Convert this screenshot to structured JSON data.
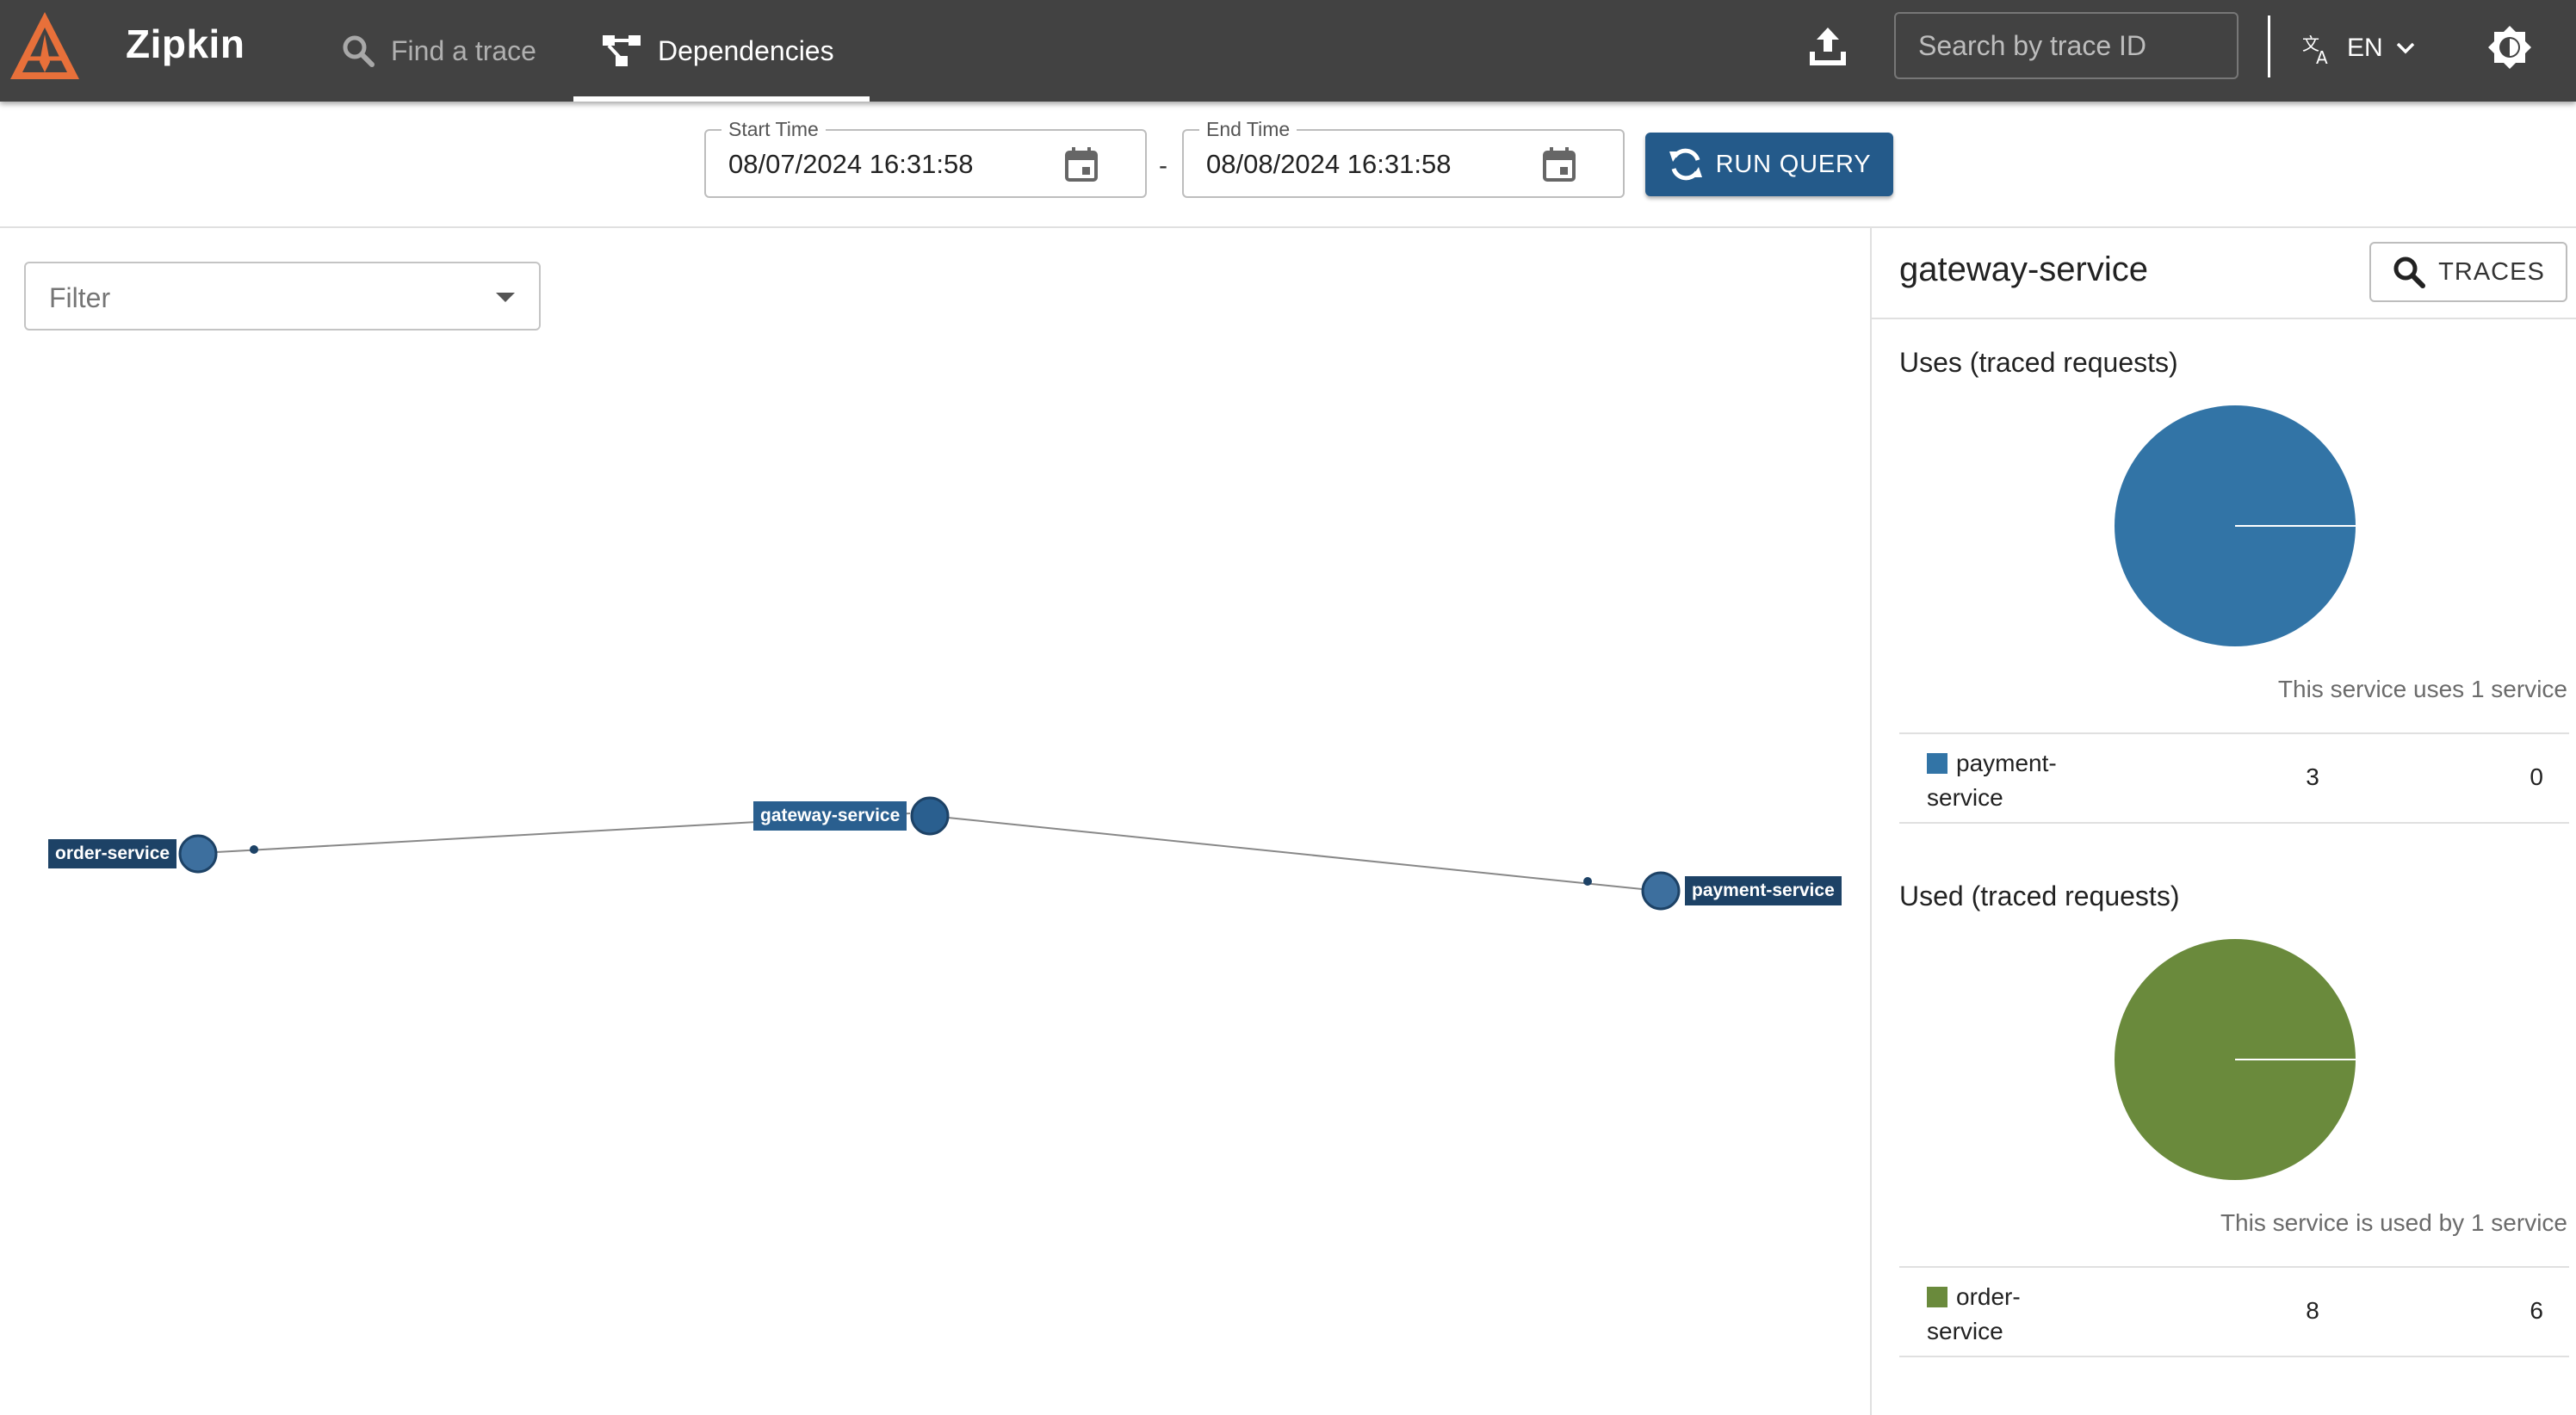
{
  "app": {
    "brand": "Zipkin",
    "logo_icon": "zipkin-logo-icon",
    "accent_color": "#e8703a"
  },
  "nav": {
    "find_trace": "Find a trace",
    "dependencies": "Dependencies"
  },
  "header": {
    "search_placeholder": "Search by trace ID",
    "language": "EN"
  },
  "query": {
    "start_label": "Start Time",
    "start_value": "08/07/2024 16:31:58",
    "separator": "-",
    "end_label": "End Time",
    "end_value": "08/08/2024 16:31:58",
    "run_label": "RUN QUERY"
  },
  "filter": {
    "placeholder": "Filter"
  },
  "graph": {
    "nodes": [
      {
        "id": "order",
        "label": "order-service",
        "color": "#1d4266"
      },
      {
        "id": "gateway",
        "label": "gateway-service",
        "color": "#2a5f8f"
      },
      {
        "id": "payment",
        "label": "payment-service",
        "color": "#1d4266"
      }
    ]
  },
  "panel": {
    "service_name": "gateway-service",
    "traces_label": "TRACES",
    "uses": {
      "title": "Uses (traced requests)",
      "caption": "This service uses 1 service",
      "color": "#3274a6",
      "rows": [
        {
          "name": "payment-service",
          "count": "3",
          "errors": "0"
        }
      ]
    },
    "used": {
      "title": "Used (traced requests)",
      "caption": "This service is used by 1 service",
      "color": "#6a8a3c",
      "rows": [
        {
          "name": "order-service",
          "count": "8",
          "errors": "6"
        }
      ]
    }
  }
}
